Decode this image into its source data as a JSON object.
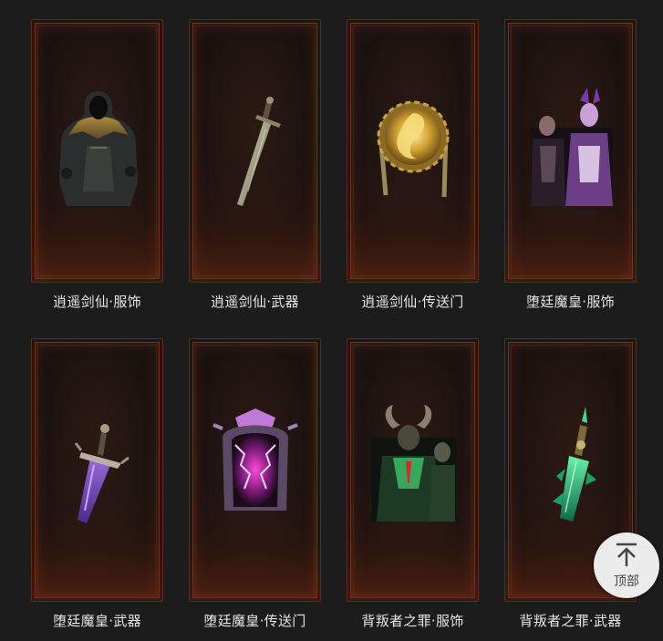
{
  "items": [
    {
      "label": "逍遥剑仙·服饰",
      "icon": "cloaked-figure-icon"
    },
    {
      "label": "逍遥剑仙·武器",
      "icon": "sword-icon"
    },
    {
      "label": "逍遥剑仙·传送门",
      "icon": "golden-portal-icon"
    },
    {
      "label": "堕廷魔皇·服饰",
      "icon": "demon-lords-icon"
    },
    {
      "label": "堕廷魔皇·武器",
      "icon": "purple-dagger-icon"
    },
    {
      "label": "堕廷魔皇·传送门",
      "icon": "purple-portal-icon"
    },
    {
      "label": "背叛者之罪·服饰",
      "icon": "horned-warriors-icon"
    },
    {
      "label": "背叛者之罪·武器",
      "icon": "green-blade-icon"
    }
  ],
  "back_to_top": {
    "label": "顶部",
    "icon": "arrow-up-icon"
  }
}
